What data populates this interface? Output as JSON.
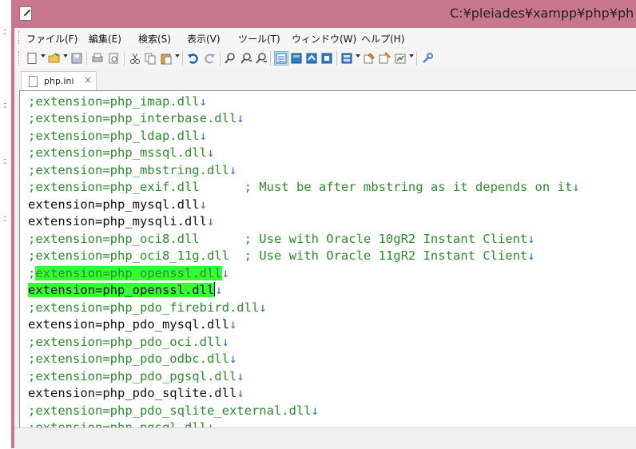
{
  "window": {
    "title": "C:¥pleiades¥xampp¥php¥ph"
  },
  "menu": [
    "ファイル(F)",
    "編集(E)",
    "検索(S)",
    "表示(V)",
    "ツール(T)",
    "ウィンドウ(W)",
    "ヘルプ(H)"
  ],
  "toolbar": {
    "icons": [
      "new-file-icon",
      "open-folder-icon",
      "save-icon",
      "print-icon",
      "print-preview-icon",
      "cut-icon",
      "copy-icon",
      "paste-icon",
      "undo-icon",
      "redo-icon",
      "find-icon",
      "find-next-icon",
      "find-previous-icon",
      "view-toggle-icon",
      "compare-icon",
      "sync-icon",
      "macro-icon",
      "settings-icon",
      "tools-icon",
      "window-icon",
      "help-tool-icon"
    ]
  },
  "tab": {
    "label": "php.ini",
    "close": "×"
  },
  "editor": {
    "eol_marker": "↓",
    "lines": [
      {
        "text": ";extension=php_imap.dll",
        "type": "comment"
      },
      {
        "text": ";extension=php_interbase.dll",
        "type": "comment"
      },
      {
        "text": ";extension=php_ldap.dll",
        "type": "comment"
      },
      {
        "text": ";extension=php_mssql.dll",
        "type": "comment"
      },
      {
        "text": ";extension=php_mbstring.dll",
        "type": "comment"
      },
      {
        "text": ";extension=php_exif.dll      ; Must be after mbstring as it depends on it",
        "type": "comment"
      },
      {
        "text": "extension=php_mysql.dll",
        "type": "normal"
      },
      {
        "text": "extension=php_mysqli.dll",
        "type": "normal"
      },
      {
        "text": ";extension=php_oci8.dll      ; Use with Oracle 10gR2 Instant Client",
        "type": "comment"
      },
      {
        "text": ";extension=php_oci8_11g.dll  ; Use with Oracle 11gR2 Instant Client",
        "type": "comment"
      },
      {
        "text": ";extension=php_openssl.dll",
        "type": "comment-highlight"
      },
      {
        "text": "extension=php_openssl.dll",
        "type": "normal-highlight"
      },
      {
        "text": ";extension=php_pdo_firebird.dll",
        "type": "comment"
      },
      {
        "text": "extension=php_pdo_mysql.dll",
        "type": "normal"
      },
      {
        "text": ";extension=php_pdo_oci.dll",
        "type": "comment"
      },
      {
        "text": ";extension=php_pdo_odbc.dll",
        "type": "comment"
      },
      {
        "text": ";extension=php_pdo_pgsql.dll",
        "type": "comment"
      },
      {
        "text": "extension=php_pdo_sqlite.dll",
        "type": "normal"
      },
      {
        "text": ";extension=php_pdo_sqlite_external.dll",
        "type": "comment"
      },
      {
        "text": ";extension=php_pgsql.dll",
        "type": "comment"
      }
    ]
  },
  "colors": {
    "titlebar": "#c8778f",
    "comment": "#2e8b2e",
    "normal": "#111111",
    "eol": "#2f6fd6",
    "highlight": "#33ff33"
  }
}
